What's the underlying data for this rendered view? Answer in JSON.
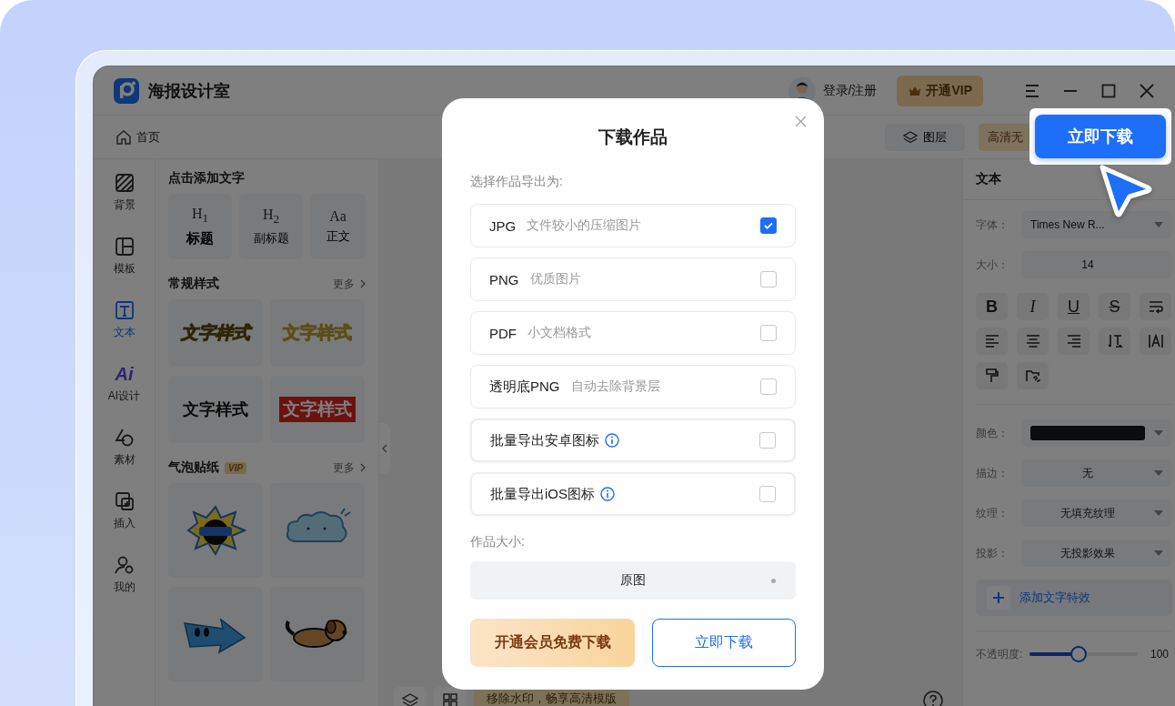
{
  "app": {
    "name": "海报设计室"
  },
  "header": {
    "login": "登录/注册",
    "vip": "开通VIP"
  },
  "toolbar": {
    "home": "首页",
    "layers": "图层",
    "hd": "高清无"
  },
  "rail": [
    {
      "kind": "background",
      "label": "背景",
      "selected": false
    },
    {
      "kind": "template",
      "label": "模板",
      "selected": false
    },
    {
      "kind": "text",
      "label": "文本",
      "selected": true
    },
    {
      "kind": "ai",
      "glyph": "Ai",
      "label": "AI设计",
      "selected": false
    },
    {
      "kind": "material",
      "label": "素材",
      "selected": false
    },
    {
      "kind": "insert",
      "label": "插入",
      "selected": false
    },
    {
      "kind": "mine",
      "label": "我的",
      "selected": false
    }
  ],
  "text_panel": {
    "title": "点击添加文字",
    "presets": [
      {
        "glyph": "H$_{1}$",
        "label": "标题",
        "kind": "title"
      },
      {
        "glyph": "H$_{2}$",
        "label": "副标题",
        "kind": "subtitle"
      },
      {
        "glyph": "Aa",
        "label": "正文",
        "kind": "body"
      }
    ],
    "styles": {
      "title": "常规样式",
      "more": "更多",
      "items": [
        {
          "kind": "gold",
          "text": "文字样式"
        },
        {
          "kind": "outline",
          "text": "文字样式"
        },
        {
          "kind": "black",
          "text": "文字样式"
        },
        {
          "kind": "red",
          "text": "文字样式"
        }
      ]
    },
    "stickers": {
      "title": "气泡贴纸",
      "badge": "VIP",
      "more": "更多",
      "items": [
        {
          "kind": "bomb"
        },
        {
          "kind": "cloud"
        },
        {
          "kind": "arrow"
        },
        {
          "kind": "dog"
        }
      ]
    }
  },
  "canvas": {
    "banner": "移除水印，畅享高清模版"
  },
  "right_panel": {
    "title": "文本",
    "font": {
      "label": "字体：",
      "value": "Times New R..."
    },
    "size": {
      "label": "大小：",
      "value": "14"
    },
    "format_tools": [
      {
        "kind": "bold",
        "glyph": "B"
      },
      {
        "kind": "italic",
        "glyph": "I"
      },
      {
        "kind": "underline",
        "glyph": "U"
      },
      {
        "kind": "strike",
        "glyph": "S"
      },
      {
        "kind": "wrap"
      },
      {
        "kind": "align-left"
      },
      {
        "kind": "align-center"
      },
      {
        "kind": "align-right"
      },
      {
        "kind": "line-height"
      },
      {
        "kind": "spacing"
      },
      {
        "kind": "brush"
      },
      {
        "kind": "link"
      }
    ],
    "color": {
      "label": "颜色：",
      "color": "#16181d"
    },
    "selects": [
      {
        "label": "描边：",
        "value": "无"
      },
      {
        "label": "纹理：",
        "value": "无填充纹理"
      },
      {
        "label": "投影：",
        "value": "无投影效果"
      }
    ],
    "add_effect": "添加文字特效",
    "opacity": {
      "label": "不透明度:",
      "level": 0.45,
      "reading": "100"
    }
  },
  "dialog": {
    "title": "下载作品",
    "prompt": "选择作品导出为:",
    "options": [
      {
        "format": "JPG",
        "description": "文件较小的压缩图片",
        "info": false,
        "checked": true
      },
      {
        "format": "PNG",
        "description": "优质图片",
        "info": false,
        "checked": false
      },
      {
        "format": "PDF",
        "description": "小文档格式",
        "info": false,
        "checked": false
      },
      {
        "format": "透明底PNG",
        "description": "自动去除背景层",
        "info": false,
        "checked": false
      },
      {
        "format": "批量导出安卓图标",
        "info": true,
        "checked": false
      },
      {
        "format": "批量导出iOS图标",
        "info": true,
        "checked": false
      }
    ],
    "size_label": "作品大小:",
    "size_value": "原图",
    "vip_button": "开通会员免费下载",
    "download_button": "立即下载"
  },
  "highlight_button": "立即下载"
}
